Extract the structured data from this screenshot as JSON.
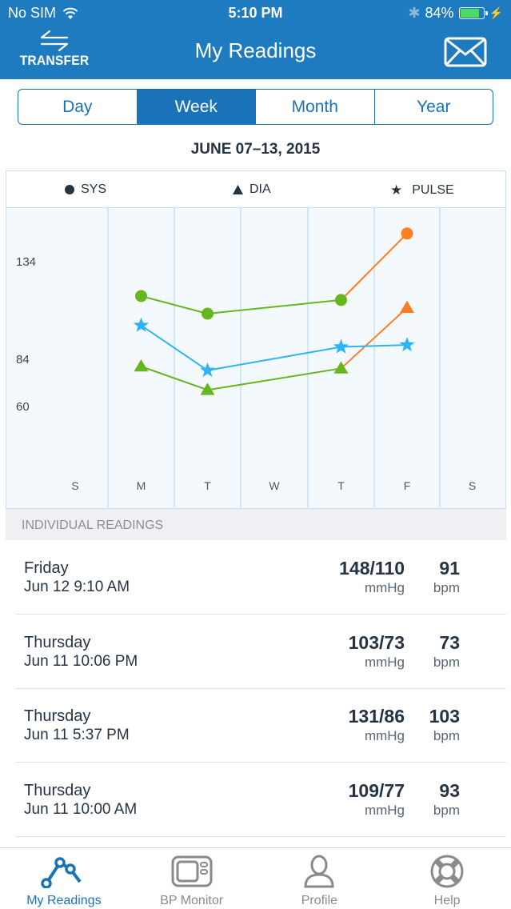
{
  "status_bar": {
    "carrier": "No SIM",
    "time": "5:10 PM",
    "battery": "84%",
    "battery_level": 0.84
  },
  "header": {
    "transfer_label": "TRANSFER",
    "title": "My Readings",
    "mail_icon": "envelope-icon"
  },
  "period_tabs": [
    {
      "label": "Day",
      "active": false
    },
    {
      "label": "Week",
      "active": true
    },
    {
      "label": "Month",
      "active": false
    },
    {
      "label": "Year",
      "active": false
    }
  ],
  "date_range": "JUNE 07–13, 2015",
  "legend": {
    "sys": "SYS",
    "dia": "DIA",
    "pulse": "PULSE"
  },
  "colors": {
    "brand": "#1f7bc0",
    "normal": "#66b71e",
    "high": "#fd7f23",
    "pulse": "#2db4f6",
    "grid": "#c5e0f5"
  },
  "chart_data": {
    "type": "line",
    "title": "",
    "categories": [
      "S",
      "M",
      "T",
      "W",
      "T",
      "F",
      "S"
    ],
    "y_ticks": [
      134,
      84,
      60
    ],
    "ylim": [
      8,
      161
    ],
    "grid": true,
    "legend_position": "top",
    "series": [
      {
        "name": "SYS",
        "marker": "circle",
        "values": [
          null,
          116,
          107,
          null,
          114,
          148,
          null
        ],
        "point_status": [
          null,
          "normal",
          "normal",
          null,
          "normal",
          "high",
          null
        ]
      },
      {
        "name": "DIA",
        "marker": "triangle",
        "values": [
          null,
          80,
          68,
          null,
          79,
          110,
          null
        ],
        "point_status": [
          null,
          "normal",
          "normal",
          null,
          "normal",
          "high",
          null
        ]
      },
      {
        "name": "PULSE",
        "marker": "star",
        "values": [
          null,
          101,
          78,
          null,
          90,
          91,
          null
        ],
        "point_status": [
          null,
          "pulse",
          "pulse",
          null,
          "pulse",
          "pulse",
          null
        ]
      }
    ]
  },
  "readings_section": {
    "title": "INDIVIDUAL READINGS",
    "items": [
      {
        "day": "Friday",
        "datetime": "Jun 12 9:10 AM",
        "bp": "148/110",
        "bp_unit": "mmHg",
        "pulse": "91",
        "pulse_unit": "bpm"
      },
      {
        "day": "Thursday",
        "datetime": "Jun 11 10:06 PM",
        "bp": "103/73",
        "bp_unit": "mmHg",
        "pulse": "73",
        "pulse_unit": "bpm"
      },
      {
        "day": "Thursday",
        "datetime": "Jun 11 5:37 PM",
        "bp": "131/86",
        "bp_unit": "mmHg",
        "pulse": "103",
        "pulse_unit": "bpm"
      },
      {
        "day": "Thursday",
        "datetime": "Jun 11 10:00 AM",
        "bp": "109/77",
        "bp_unit": "mmHg",
        "pulse": "93",
        "pulse_unit": "bpm"
      }
    ]
  },
  "tab_bar": [
    {
      "label": "My Readings",
      "icon": "chart-line-icon",
      "active": true
    },
    {
      "label": "BP Monitor",
      "icon": "monitor-icon",
      "active": false
    },
    {
      "label": "Profile",
      "icon": "person-icon",
      "active": false
    },
    {
      "label": "Help",
      "icon": "lifebuoy-icon",
      "active": false
    }
  ]
}
